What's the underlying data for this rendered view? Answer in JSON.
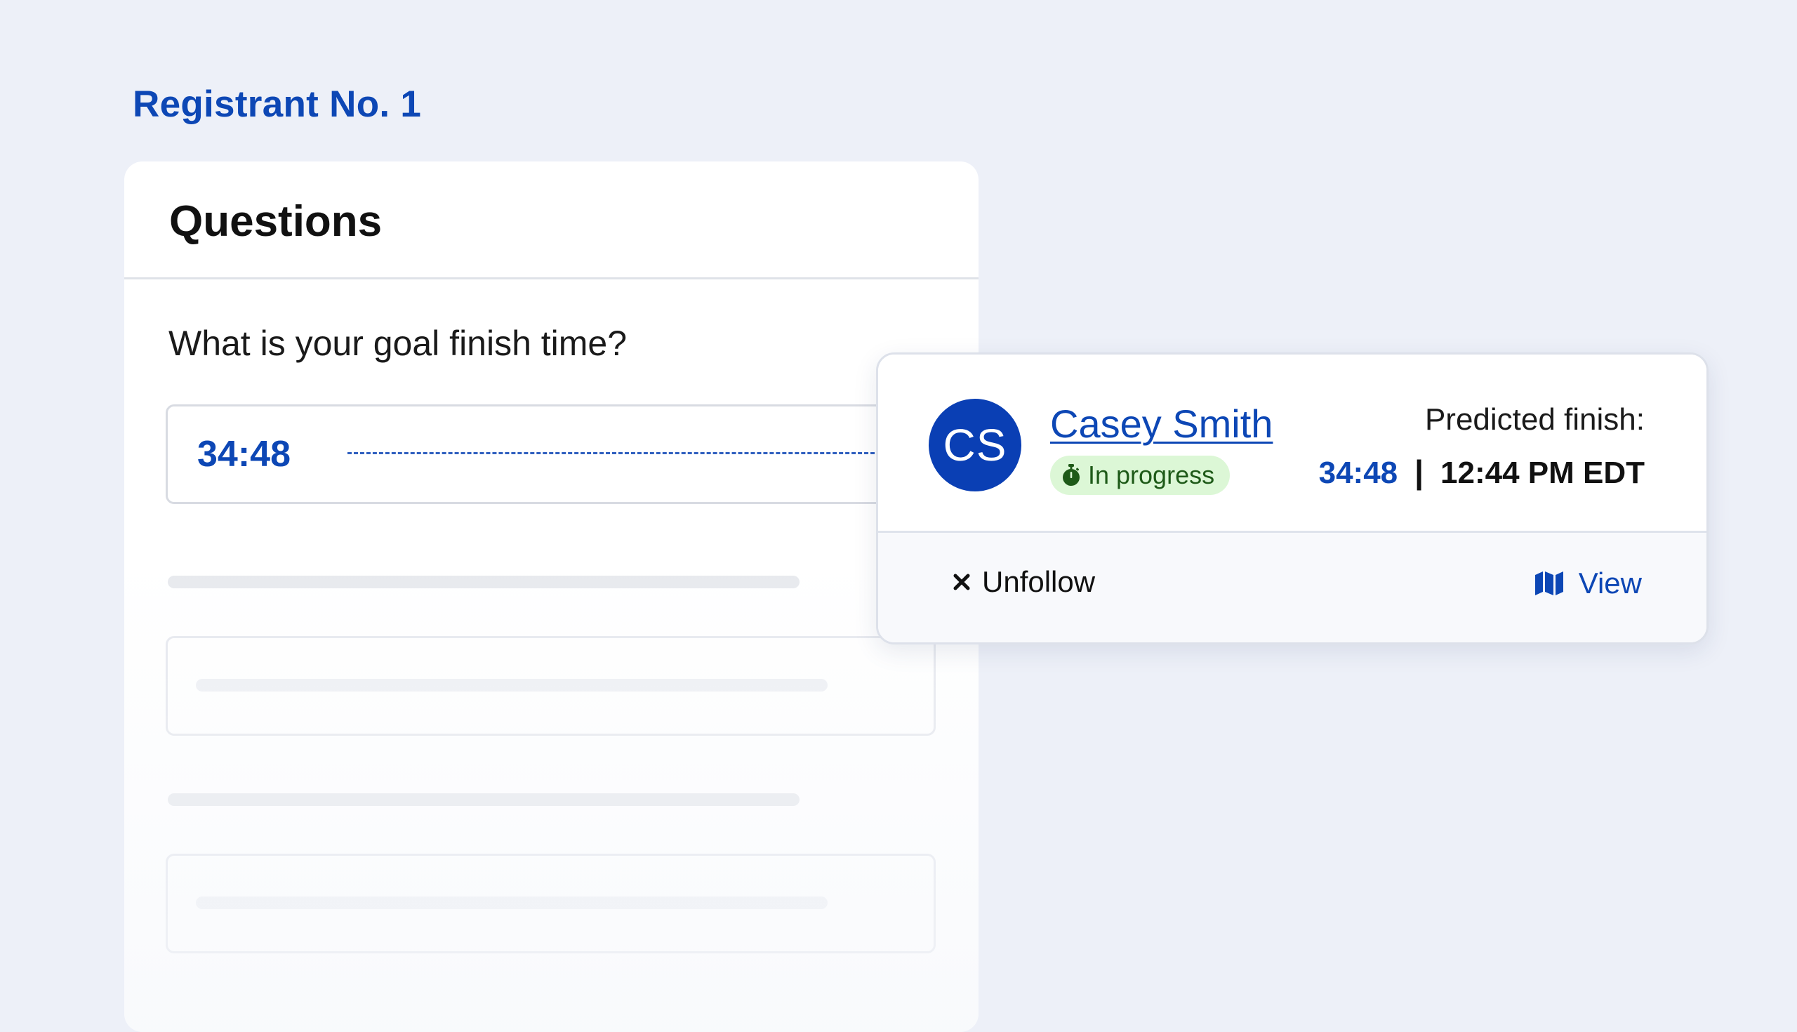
{
  "page": {
    "section_title": "Registrant No. 1"
  },
  "questions": {
    "title": "Questions",
    "question": "What is your goal finish time?",
    "answer": "34:48"
  },
  "runner_card": {
    "initials": "CS",
    "name": "Casey Smith",
    "status": "In progress",
    "predicted_label": "Predicted finish:",
    "predicted_time": "34:48",
    "separator": "|",
    "predicted_clock": "12:44 PM EDT",
    "unfollow_label": "Unfollow",
    "view_label": "View"
  },
  "colors": {
    "background": "#edf0f8",
    "accent": "#0d47b5",
    "avatar": "#0a3fb4",
    "status_bg": "#dcf7d6",
    "status_text": "#1e5a18"
  },
  "icons": {
    "status": "stopwatch-icon",
    "unfollow": "close-icon",
    "view": "map-icon"
  }
}
